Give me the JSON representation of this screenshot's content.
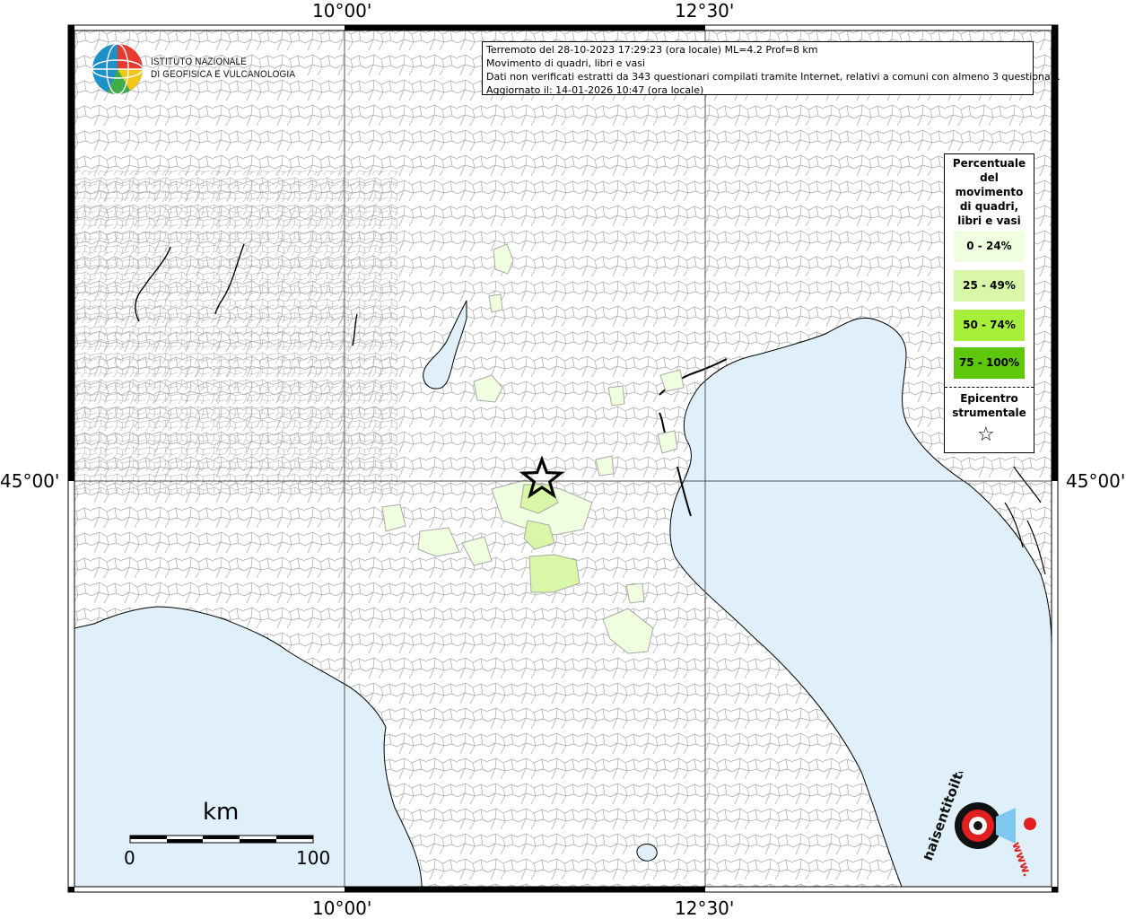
{
  "map": {
    "graticule": {
      "top_labels": [
        "10°00'",
        "12°30'"
      ],
      "bottom_labels": [
        "10°00'",
        "12°30'"
      ],
      "left_labels": [
        "45°00'"
      ],
      "right_labels": [
        "45°00'"
      ]
    },
    "colors": {
      "sea": "#dff0fb",
      "land": "#ffffff",
      "municipality_border": "#9a9a9a",
      "class_0_24": "#efffdf",
      "class_25_49": "#d8f7a8",
      "class_50_74": "#a6f03c",
      "class_75_100": "#5fc70a"
    }
  },
  "logo": {
    "line1": "ISTITUTO NAZIONALE",
    "line2": "DI GEOFISICA E VULCANOLOGIA"
  },
  "info_box": {
    "line1": "Terremoto del 28-10-2023 17:29:23 (ora locale) ML=4.2 Prof=8 km",
    "line2": "Movimento di quadri, libri e vasi",
    "line3": "Dati non verificati estratti da 343 questionari compilati tramite Internet, relativi a comuni con almeno 3 questionari.",
    "line4": "Aggiornato il: 14-01-2026 10:47 (ora locale)"
  },
  "legend": {
    "title_lines": [
      "Percentuale",
      "del",
      "movimento",
      "di quadri,",
      "libri e vasi"
    ],
    "classes": [
      {
        "label": "0 - 24%",
        "color": "#efffdf"
      },
      {
        "label": "25 - 49%",
        "color": "#d8f7a8"
      },
      {
        "label": "50 - 74%",
        "color": "#a6f03c"
      },
      {
        "label": "75 - 100%",
        "color": "#5fc70a"
      }
    ],
    "epicenter_lines": [
      "Epicentro",
      "strumentale"
    ],
    "epicenter_icon": "star-outline-icon"
  },
  "scale_bar": {
    "unit": "km",
    "min_label": "0",
    "max_label": "100"
  },
  "watermark": {
    "text": "haisentitoilterremoto.it",
    "url_text": "www."
  }
}
